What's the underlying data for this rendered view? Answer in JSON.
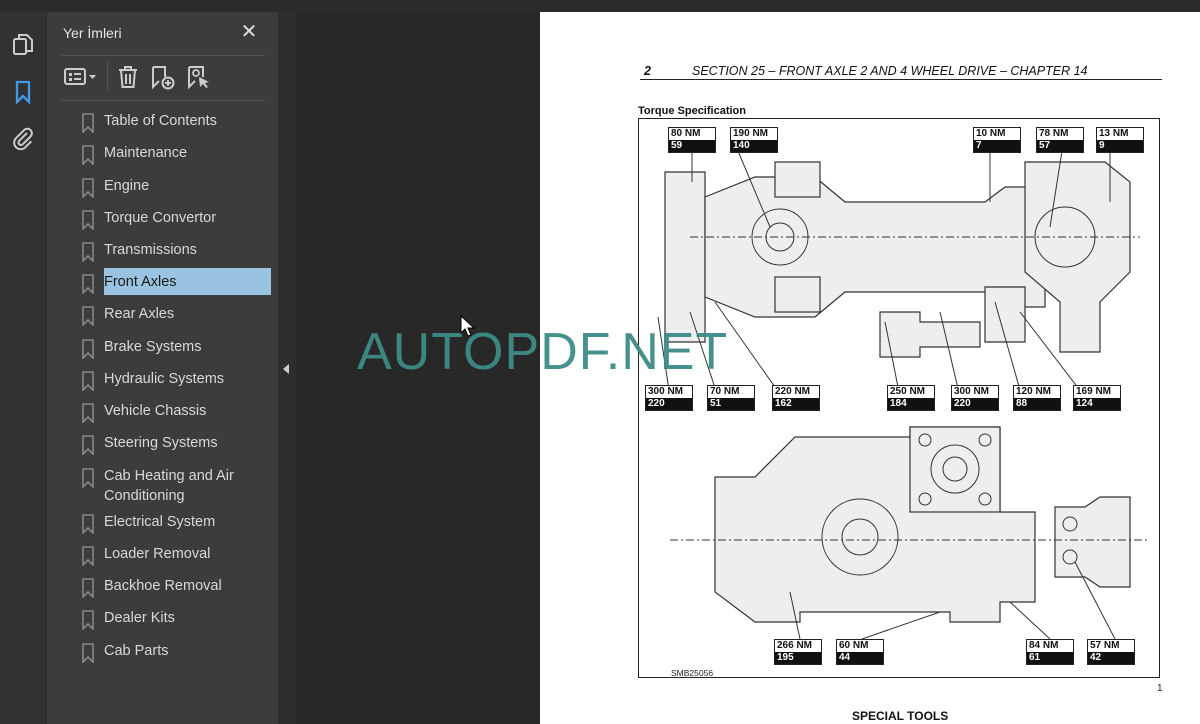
{
  "panel": {
    "title": "Yer İmleri",
    "close_icon": "close-icon"
  },
  "toolbar": {
    "icons": [
      "bookmark-options-icon",
      "delete-icon",
      "add-bookmark-icon",
      "find-current-bookmark-icon"
    ]
  },
  "rail": {
    "icons": [
      "pages-icon",
      "bookmarks-icon",
      "attachments-icon"
    ],
    "active": "bookmarks-icon"
  },
  "bookmarks": [
    {
      "label": "Table of Contents"
    },
    {
      "label": "Maintenance"
    },
    {
      "label": "Engine"
    },
    {
      "label": "Torque Convertor"
    },
    {
      "label": "Transmissions"
    },
    {
      "label": "Front Axles",
      "selected": true
    },
    {
      "label": "Rear Axles"
    },
    {
      "label": "Brake Systems"
    },
    {
      "label": "Hydraulic Systems"
    },
    {
      "label": "Vehicle Chassis"
    },
    {
      "label": "Steering Systems"
    },
    {
      "label": "Cab Heating and Air Conditioning"
    },
    {
      "label": "Electrical System"
    },
    {
      "label": "Loader Removal"
    },
    {
      "label": "Backhoe Removal"
    },
    {
      "label": "Dealer Kits"
    },
    {
      "label": "Cab Parts"
    }
  ],
  "colors": {
    "selected": "#99c3e1",
    "accent": "#3d9be9",
    "watermark": "#3e8c87"
  },
  "document": {
    "page_number": "2",
    "section_title": "SECTION 25 – FRONT AXLE 2 AND 4 WHEEL DRIVE – CHAPTER 14",
    "heading": "Torque Specification",
    "figure_id": "SMB25056",
    "figure_number": "1",
    "next_heading": "SPECIAL TOOLS",
    "watermark": "AUTOPDF.NET",
    "torque_labels": [
      {
        "nm": "80 NM",
        "lbft": "59"
      },
      {
        "nm": "190 NM",
        "lbft": "140"
      },
      {
        "nm": "10 NM",
        "lbft": "7"
      },
      {
        "nm": "78 NM",
        "lbft": "57"
      },
      {
        "nm": "13 NM",
        "lbft": "9"
      },
      {
        "nm": "300 NM",
        "lbft": "220"
      },
      {
        "nm": "70 NM",
        "lbft": "51"
      },
      {
        "nm": "220 NM",
        "lbft": "162"
      },
      {
        "nm": "250 NM",
        "lbft": "184"
      },
      {
        "nm": "300 NM",
        "lbft": "220"
      },
      {
        "nm": "120 NM",
        "lbft": "88"
      },
      {
        "nm": "169 NM",
        "lbft": "124"
      },
      {
        "nm": "266 NM",
        "lbft": "195"
      },
      {
        "nm": "60 NM",
        "lbft": "44"
      },
      {
        "nm": "84 NM",
        "lbft": "61"
      },
      {
        "nm": "57 NM",
        "lbft": "42"
      }
    ]
  }
}
